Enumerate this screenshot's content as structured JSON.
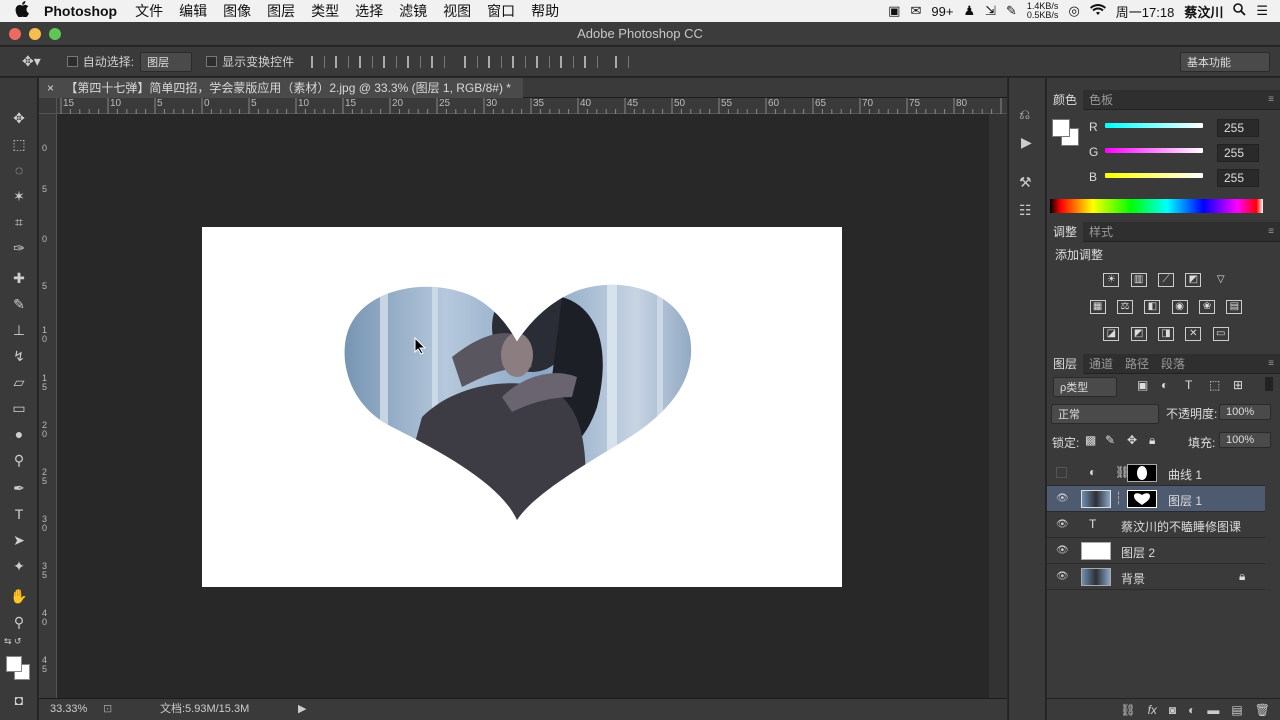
{
  "menubar": {
    "apple": "",
    "app": "Photoshop",
    "items": [
      "文件",
      "编辑",
      "图像",
      "图层",
      "类型",
      "选择",
      "滤镜",
      "视图",
      "窗口",
      "帮助"
    ],
    "wechat_badge": "99+",
    "net_up": "1.4KB/s",
    "net_down": "0.5KB/s",
    "clock": "周一17:18",
    "user": "蔡汶川"
  },
  "window": {
    "title": "Adobe Photoshop CC"
  },
  "options": {
    "auto_select_label": "自动选择:",
    "auto_select_value": "图层",
    "show_transform_label": "显示变换控件",
    "workspace": "基本功能"
  },
  "document": {
    "tab_title": "【第四十七弹】简单四招，学会蒙版应用（素材）2.jpg @ 33.3% (图层 1, RGB/8#) *",
    "ruler_h": [
      "15",
      "10",
      "5",
      "0",
      "5",
      "10",
      "15",
      "20",
      "25",
      "30",
      "35",
      "40",
      "45",
      "50",
      "55",
      "60",
      "65",
      "70",
      "75",
      "80"
    ],
    "ruler_v": [
      "0",
      "5",
      "0",
      "5",
      "1 0",
      "1 5",
      "2 0",
      "2 5",
      "3 0",
      "3 5",
      "4 0",
      "4 5"
    ],
    "zoom": "33.33%",
    "doc_size": "文档:5.93M/15.3M"
  },
  "color_panel": {
    "tabs": [
      "颜色",
      "色板"
    ],
    "r_label": "R",
    "r_value": "255",
    "g_label": "G",
    "g_value": "255",
    "b_label": "B",
    "b_value": "255"
  },
  "adjust_panel": {
    "tabs": [
      "调整",
      "样式"
    ],
    "title": "添加调整"
  },
  "layers_panel": {
    "tabs": [
      "图层",
      "通道",
      "路径",
      "段落"
    ],
    "filter_kind": "ρ类型",
    "blend_mode": "正常",
    "opacity_label": "不透明度:",
    "opacity_value": "100%",
    "lock_label": "锁定:",
    "fill_label": "填充:",
    "fill_value": "100%",
    "layers": [
      {
        "name": "曲线 1"
      },
      {
        "name": "图层 1"
      },
      {
        "name": "蔡汶川的不瞌睡修图课"
      },
      {
        "name": "图层 2"
      },
      {
        "name": "背景"
      }
    ]
  },
  "icons": {
    "search": "search-icon",
    "wifi": "wifi-icon",
    "menu": "list-icon"
  }
}
